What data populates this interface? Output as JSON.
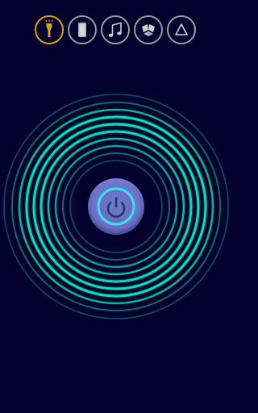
{
  "mode_bar": {
    "buttons": [
      {
        "icon": "flashlight-icon",
        "active": true
      },
      {
        "icon": "screen-light-icon",
        "active": false
      },
      {
        "icon": "music-note-icon",
        "active": false
      },
      {
        "icon": "strobe-fan-icon",
        "active": false
      },
      {
        "icon": "warning-triangle-icon",
        "active": false
      }
    ]
  },
  "power": {
    "icon": "power-icon",
    "state": "off"
  },
  "colors": {
    "background": "#02012e",
    "active_ring": "#e0a117",
    "inactive_ring": "#9c9c9c",
    "wave_bright": "#00d9a8",
    "wave_dim": "#0a4f63",
    "power_glow": "#3ce0f0"
  }
}
